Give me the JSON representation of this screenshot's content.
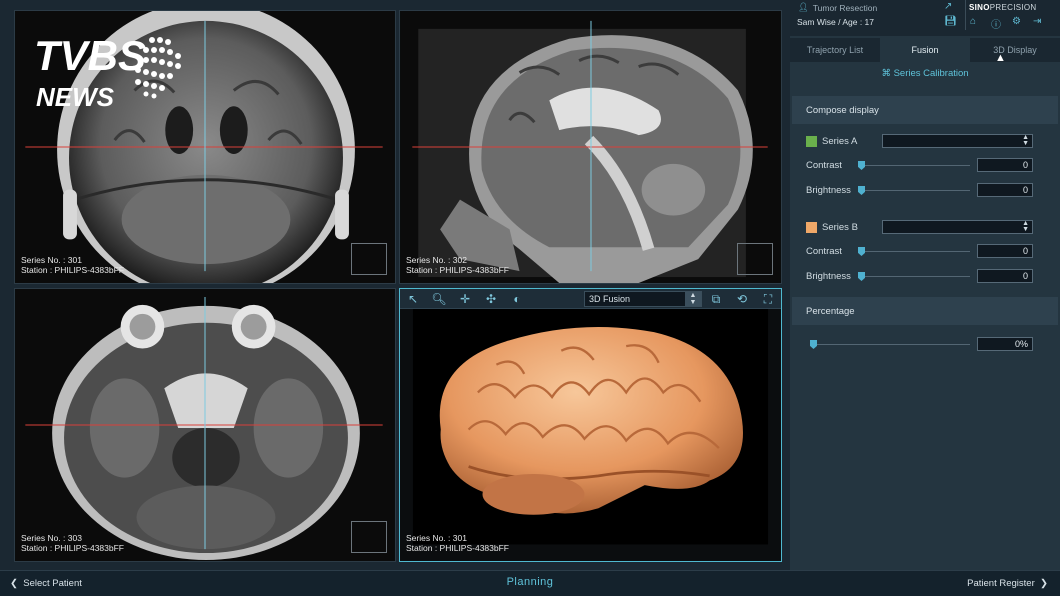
{
  "watermark": {
    "line1": "TVBS",
    "line2": "NEWS"
  },
  "header": {
    "procedure": "Tumor Resection",
    "patient": "Sam Wise / Age : 17",
    "brand_bold": "SINO",
    "brand_rest": "PRECISION"
  },
  "tabs": [
    {
      "label": "Trajectory List"
    },
    {
      "label": "Fusion"
    },
    {
      "label": "3D Display"
    }
  ],
  "fusion": {
    "calibration_label": "Series Calibration",
    "compose_title": "Compose display",
    "series_a": {
      "label": "Series A",
      "color": "#6ab04c",
      "selected": "",
      "contrast_label": "Contrast",
      "contrast_value": "0",
      "brightness_label": "Brightness",
      "brightness_value": "0"
    },
    "series_b": {
      "label": "Series B",
      "color": "#f0a868",
      "selected": "",
      "contrast_label": "Contrast",
      "contrast_value": "0",
      "brightness_label": "Brightness",
      "brightness_value": "0"
    },
    "percentage_title": "Percentage",
    "percentage_value": "0%"
  },
  "viewports": [
    {
      "series": "Series No. : 301",
      "station": "Station : PHILIPS-4383bFF"
    },
    {
      "series": "Series No. : 302",
      "station": "Station : PHILIPS-4383bFF"
    },
    {
      "series": "Series No. : 303",
      "station": "Station : PHILIPS-4383bFF"
    },
    {
      "series": "Series No. : 301",
      "station": "Station : PHILIPS-4383bFF"
    }
  ],
  "render_mode": "3D Fusion",
  "toolbar_icons": [
    "pointer-icon",
    "zoom-icon",
    "pan-icon",
    "rotate-icon",
    "contrast-icon"
  ],
  "footer": {
    "back_label": "Select Patient",
    "stage": "Planning",
    "next_label": "Patient Register"
  },
  "colors": {
    "accent": "#5fc3da",
    "crosshair_red": "#d8403a",
    "crosshair_cyan": "#7ccbe0"
  }
}
